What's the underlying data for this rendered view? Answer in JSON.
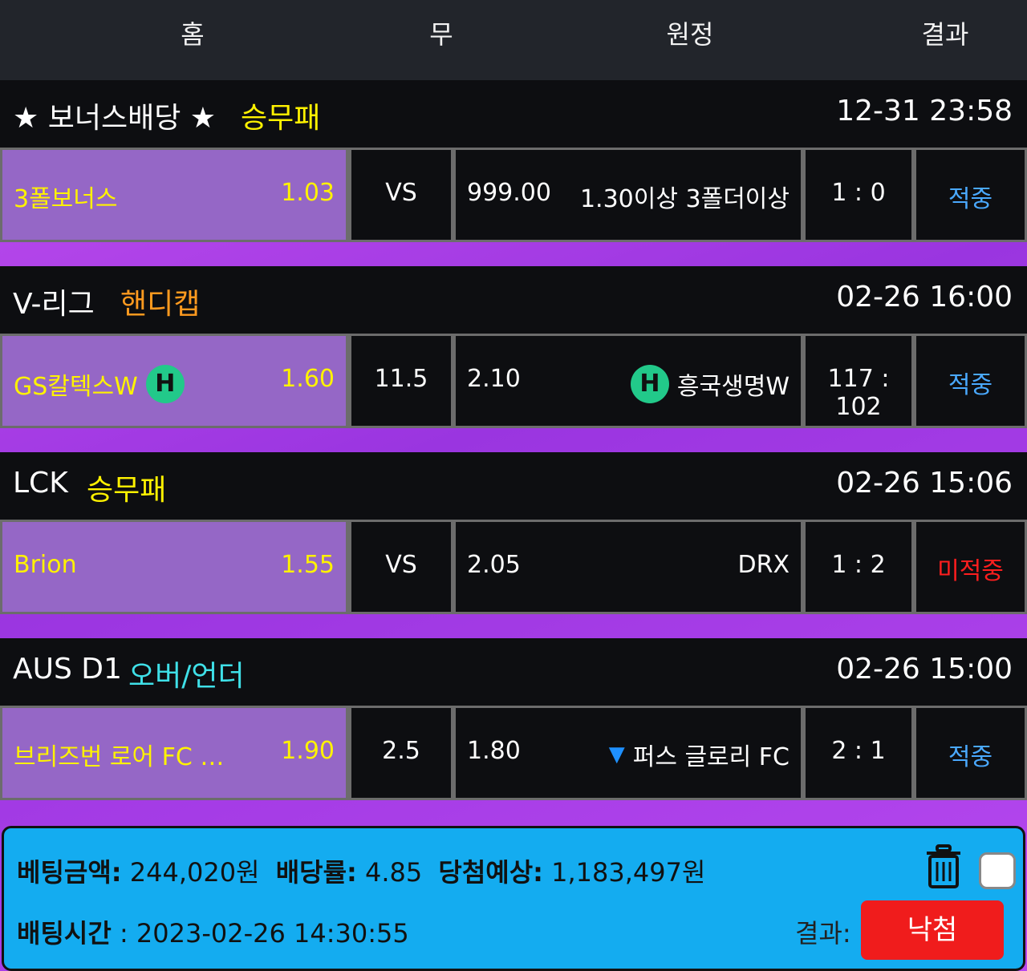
{
  "header": {
    "home": "홈",
    "draw": "무",
    "away": "원정",
    "result": "결과"
  },
  "colors": {
    "yellow": "#fff200",
    "orange": "#ff9a1f",
    "cyan": "#3fe0e8",
    "hit": "#4aa9ff",
    "miss": "#ff1e1e",
    "purple_cell": "#9567c6",
    "footer_bg": "#14acf0",
    "result_button": "#f01c1c"
  },
  "matches": [
    {
      "league": "★ 보너스배당 ★",
      "bet_type": "승무패",
      "bet_type_color": "#fff200",
      "time": "12-31 23:58",
      "home_team": "3폴보너스",
      "home_badge": "",
      "home_odd": "1.03",
      "draw": "VS",
      "away_odd": "999.00",
      "away_team": "1.30이상 3폴더이상",
      "away_badge": "",
      "away_arrow": "",
      "score": "1 : 0",
      "result": "적중",
      "result_color": "#4aa9ff"
    },
    {
      "league": "V-리그",
      "bet_type": "핸디캡",
      "bet_type_color": "#ff9a1f",
      "time": "02-26 16:00",
      "home_team": "GS칼텍스W",
      "home_badge": "H",
      "home_odd": "1.60",
      "draw": "11.5",
      "away_odd": "2.10",
      "away_team": "흥국생명W",
      "away_badge": "H",
      "away_arrow": "",
      "score": "117 : 102",
      "result": "적중",
      "result_color": "#4aa9ff"
    },
    {
      "league": "LCK",
      "bet_type": "승무패",
      "bet_type_color": "#fff200",
      "time": "02-26 15:06",
      "home_team": "Brion",
      "home_badge": "",
      "home_odd": "1.55",
      "draw": "VS",
      "away_odd": "2.05",
      "away_team": "DRX",
      "away_badge": "",
      "away_arrow": "",
      "score": "1 : 2",
      "result": "미적중",
      "result_color": "#ff1e1e"
    },
    {
      "league": "AUS D1",
      "bet_type": "오버/언더",
      "bet_type_color": "#3fe0e8",
      "time": "02-26 15:00",
      "home_team": "브리즈번 로어 FC  …",
      "home_badge": "",
      "home_odd": "1.90",
      "draw": "2.5",
      "away_odd": "1.80",
      "away_team": "퍼스 글로리 FC",
      "away_badge": "",
      "away_arrow": "▼",
      "score": "2 : 1",
      "result": "적중",
      "result_color": "#4aa9ff"
    }
  ],
  "footer": {
    "bet_amount_label": "베팅금액:",
    "bet_amount": "244,020원",
    "odds_label": "배당률:",
    "odds": "4.85",
    "expected_label": "당첨예상:",
    "expected": "1,183,497원",
    "time_label": "배팅시간",
    "time": ": 2023-02-26 14:30:55",
    "result_label": "결과:",
    "result_button": "낙첨"
  }
}
